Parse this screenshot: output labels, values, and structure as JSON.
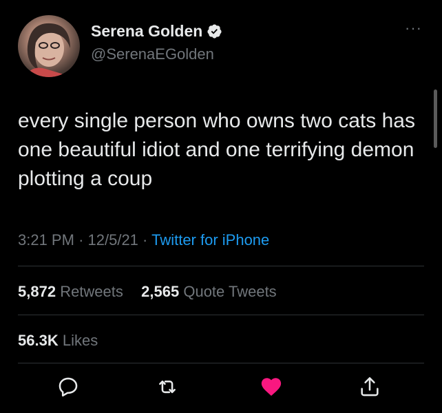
{
  "author": {
    "display_name": "Serena Golden",
    "handle": "@SerenaEGolden",
    "verified": true
  },
  "tweet": {
    "text": "every single person who owns two cats has one beautiful idiot and one terrifying demon plotting a coup",
    "time": "3:21 PM",
    "date": "12/5/21",
    "separator": "·",
    "source": "Twitter for iPhone"
  },
  "stats": {
    "retweets_count": "5,872",
    "retweets_label": "Retweets",
    "quotes_count": "2,565",
    "quotes_label": "Quote Tweets",
    "likes_count": "56.3K",
    "likes_label": "Likes"
  },
  "menu": {
    "more_label": "···"
  },
  "icons": {
    "reply": "reply-icon",
    "retweet": "retweet-icon",
    "like": "heart-icon",
    "share": "share-icon",
    "verified": "verified-badge-icon",
    "more": "more-options-icon"
  },
  "colors": {
    "background": "#000000",
    "text": "#e7e9ea",
    "secondary_text": "#71767b",
    "link": "#1d9bf0",
    "like_active": "#f91880",
    "divider": "#2f3336"
  }
}
